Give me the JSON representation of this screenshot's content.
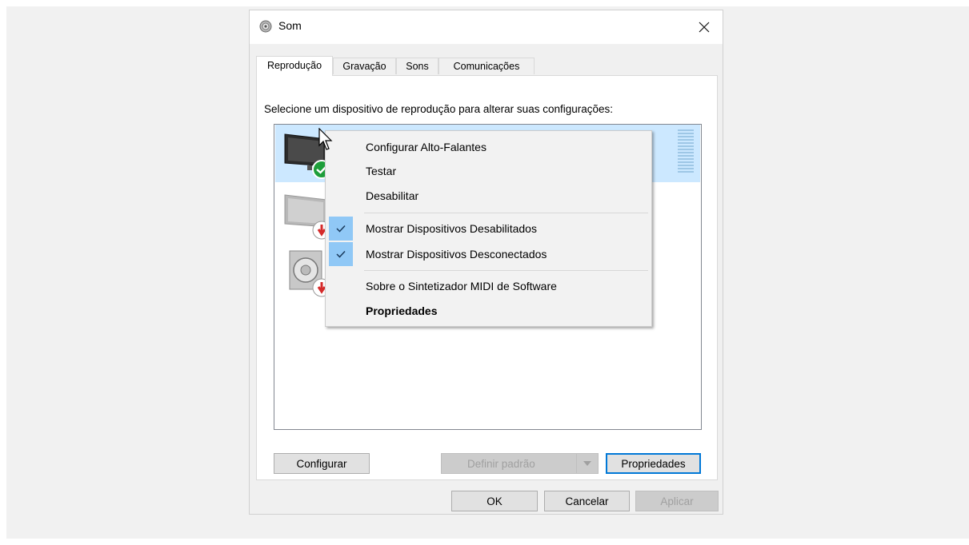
{
  "window": {
    "title": "Som",
    "close_glyph": "✕",
    "icon": "speaker-icon"
  },
  "tabs": [
    {
      "label": "Reprodução",
      "active": true
    },
    {
      "label": "Gravação",
      "active": false
    },
    {
      "label": "Sons",
      "active": false
    },
    {
      "label": "Comunicações",
      "active": false
    }
  ],
  "panel": {
    "instruction": "Selecione um dispositivo de reprodução para alterar suas configurações:"
  },
  "devices": [
    {
      "name": "",
      "status": "default",
      "icon": "monitor-icon",
      "selected": true
    },
    {
      "name": "",
      "status": "disabled",
      "icon": "monitor-icon",
      "selected": false
    },
    {
      "name": "",
      "status": "disabled",
      "icon": "speaker-icon",
      "selected": false
    }
  ],
  "context_menu": {
    "items": [
      {
        "label": "Configurar Alto-Falantes"
      },
      {
        "label": "Testar"
      },
      {
        "label": "Desabilitar"
      },
      {
        "label": "Mostrar Dispositivos Desabilitados",
        "checked": true
      },
      {
        "label": "Mostrar Dispositivos Desconectados",
        "checked": true
      },
      {
        "label": "Sobre o Sintetizador MIDI de Software"
      },
      {
        "label": "Propriedades",
        "bold": true
      }
    ]
  },
  "panel_buttons": {
    "configure": "Configurar",
    "set_default": "Definir padrão",
    "properties": "Propriedades"
  },
  "dialog_buttons": {
    "ok": "OK",
    "cancel": "Cancelar",
    "apply": "Aplicar"
  },
  "colors": {
    "selection": "#cce8ff",
    "check_highlight": "#90c8f6",
    "focus_border": "#0078d7",
    "default_badge": "#1e9e3a",
    "disabled_badge": "#d42a2a"
  }
}
